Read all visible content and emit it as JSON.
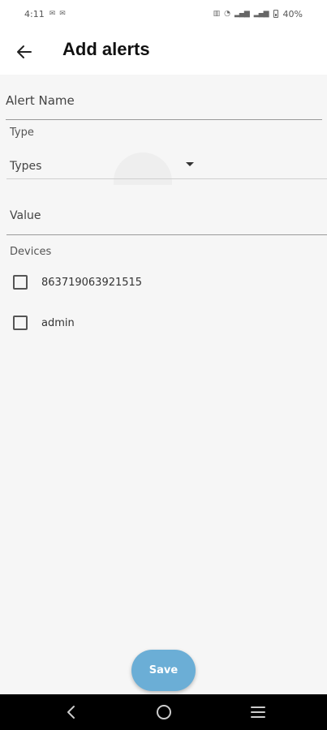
{
  "status_bar": {
    "time": "4:11",
    "left_icons": [
      "mail-icon",
      "mail-icon"
    ],
    "signal_text": "40%"
  },
  "app_bar": {
    "title": "Add alerts",
    "back_icon": "arrow-left-icon"
  },
  "form": {
    "alert_name_placeholder": "Alert Name",
    "type_label": "Type",
    "type_value": "Types",
    "value_placeholder": "Value",
    "devices_label": "Devices",
    "devices": [
      {
        "label": "863719063921515",
        "checked": false
      },
      {
        "label": "admin",
        "checked": false
      }
    ]
  },
  "save_label": "Save",
  "colors": {
    "accent": "#6baed6",
    "background": "#f6f6f6"
  }
}
